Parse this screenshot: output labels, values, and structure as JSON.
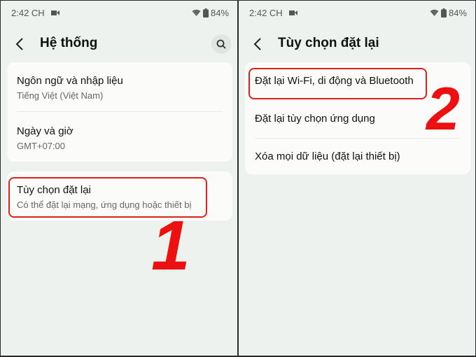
{
  "status_bar": {
    "time": "2:42 CH",
    "battery": "84%",
    "icons": [
      "video-camera-icon",
      "wifi-icon",
      "battery-icon"
    ]
  },
  "left_screen": {
    "title": "Hệ thống",
    "back_icon": "chevron-left-icon",
    "search_icon": "search-icon",
    "card1": [
      {
        "title": "Ngôn ngữ và nhập liệu",
        "subtitle": "Tiếng Việt (Việt Nam)"
      },
      {
        "title": "Ngày và giờ",
        "subtitle": "GMT+07:00"
      }
    ],
    "card2": [
      {
        "title": "Tùy chọn đặt lại",
        "subtitle": "Có thể đặt lại mạng, ứng dụng hoặc thiết bị"
      }
    ],
    "step_label": "1"
  },
  "right_screen": {
    "title": "Tùy chọn đặt lại",
    "back_icon": "chevron-left-icon",
    "items": [
      {
        "title": "Đặt lại Wi-Fi, di động và Bluetooth"
      },
      {
        "title": "Đặt lại tùy chọn ứng dụng"
      },
      {
        "title": "Xóa mọi dữ liệu (đặt lại thiết bị)"
      }
    ],
    "step_label": "2"
  },
  "colors": {
    "highlight": "#e0201c",
    "step_number": "#ec1010",
    "background": "#eef2ee",
    "card": "#fbfcfa"
  }
}
